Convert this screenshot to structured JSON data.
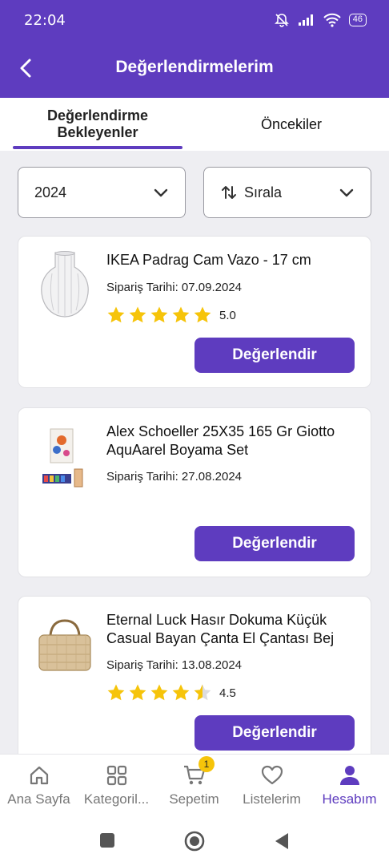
{
  "status": {
    "time": "22:04",
    "battery": "46"
  },
  "header": {
    "title": "Değerlendirmelerim"
  },
  "tabs": [
    {
      "label_line1": "Değerlendirme",
      "label_line2": "Bekleyenler",
      "active": true
    },
    {
      "label": "Öncekiler",
      "active": false
    }
  ],
  "filters": {
    "year": "2024",
    "sort": "Sırala"
  },
  "orders": [
    {
      "name": "IKEA Padrag Cam Vazo - 17 cm",
      "date": "Sipariş Tarihi: 07.09.2024",
      "rating": 5,
      "rating_label": "5.0",
      "button": "Değerlendir"
    },
    {
      "name": "Alex Schoeller 25X35 165 Gr Giotto AquAarel Boyama Set",
      "date": "Sipariş Tarihi: 27.08.2024",
      "button": "Değerlendir"
    },
    {
      "name": "Eternal Luck Hasır Dokuma Küçük Casual Bayan Çanta El Çantası Bej",
      "date": "Sipariş Tarihi: 13.08.2024",
      "rating": 4.5,
      "rating_label": "4.5",
      "button": "Değerlendir"
    }
  ],
  "nav": {
    "items": [
      {
        "label": "Ana Sayfa",
        "icon": "home-icon"
      },
      {
        "label": "Kategoril...",
        "icon": "grid-icon"
      },
      {
        "label": "Sepetim",
        "icon": "cart-icon",
        "badge": "1"
      },
      {
        "label": "Listelerim",
        "icon": "heart-icon"
      },
      {
        "label": "Hesabım",
        "icon": "person-icon",
        "active": true
      }
    ]
  },
  "colors": {
    "primary": "#5e3cbf",
    "star": "#f6c40a",
    "badge": "#f6c40a"
  }
}
